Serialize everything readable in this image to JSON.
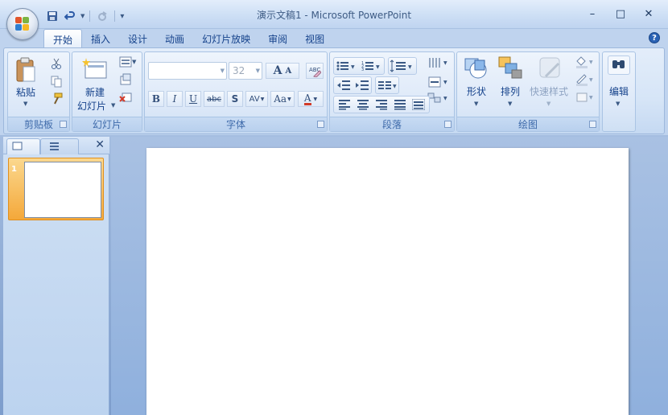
{
  "window": {
    "title": "演示文稿1 - Microsoft PowerPoint",
    "minimize": "–",
    "maximize": "□",
    "close": "✕"
  },
  "quick_access": {
    "save": "save-icon",
    "undo": "undo-icon",
    "redo": "redo-icon",
    "customize": "▾"
  },
  "tabs": [
    "开始",
    "插入",
    "设计",
    "动画",
    "幻灯片放映",
    "审阅",
    "视图"
  ],
  "active_tab": "开始",
  "help": "?",
  "ribbon": {
    "clipboard": {
      "label": "剪贴板",
      "paste": "粘贴"
    },
    "slides": {
      "label": "幻灯片",
      "new_slide_line1": "新建",
      "new_slide_line2": "幻灯片"
    },
    "font": {
      "label": "字体",
      "font_name": "",
      "font_size": "32",
      "bold": "B",
      "italic": "I",
      "underline": "U",
      "strike": "abc",
      "shadow": "S",
      "spacing": "AV",
      "case": "Aa",
      "color": "A",
      "grow": "A",
      "shrink": "A"
    },
    "paragraph": {
      "label": "段落"
    },
    "drawing": {
      "label": "绘图",
      "shapes": "形状",
      "arrange": "排列",
      "quick_styles": "快速样式"
    },
    "editing": {
      "label": "编辑",
      "binoculars": "binoculars-icon"
    }
  },
  "left_panel": {
    "tab_slides": "slides-tab-icon",
    "tab_outline": "outline-tab-icon",
    "close": "✕",
    "slides": [
      {
        "number": "1"
      }
    ]
  },
  "colors": {
    "accent": "#15428b",
    "selected_thumb": "#f4a83a",
    "ribbon": "#d6e5f7"
  }
}
